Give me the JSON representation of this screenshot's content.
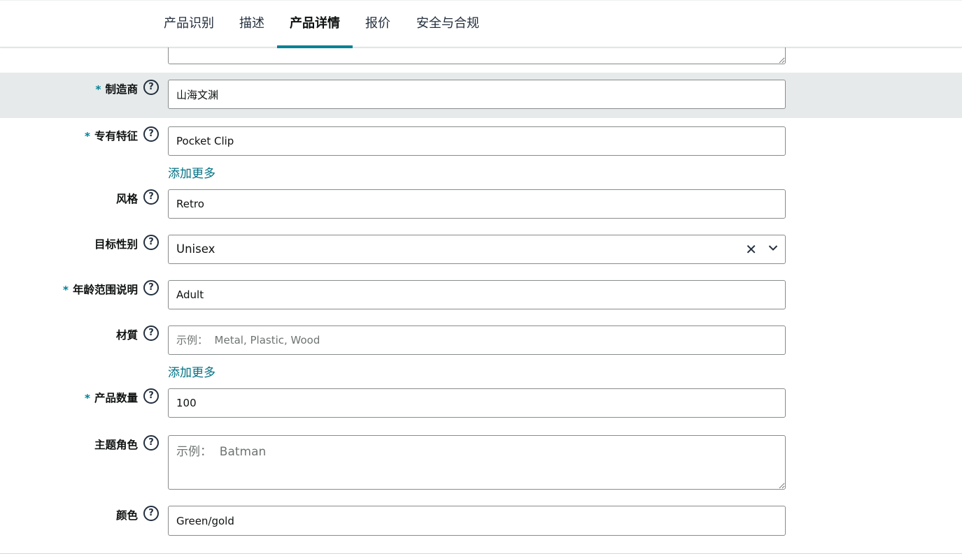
{
  "tabs": [
    {
      "label": "产品识别"
    },
    {
      "label": "描述"
    },
    {
      "label": "产品详情",
      "active": true
    },
    {
      "label": "报价"
    },
    {
      "label": "安全与合规"
    }
  ],
  "accent_color": "#008296",
  "help_icon_glyph": "?",
  "fields": {
    "manufacturer": {
      "required": "*",
      "label": "制造商",
      "value": "山海文渊"
    },
    "special_feature": {
      "required": "*",
      "label": "专有特征",
      "value": "Pocket Clip",
      "add_more": "添加更多"
    },
    "style": {
      "label": "风格",
      "value": "Retro"
    },
    "target_gender": {
      "label": "目标性别",
      "value": "Unisex",
      "clear_glyph": "✕"
    },
    "age_range": {
      "required": "*",
      "label": "年龄范围说明",
      "value": "Adult"
    },
    "material": {
      "label": "材質",
      "value": "",
      "placeholder": "示例：  Metal, Plastic, Wood",
      "add_more": "添加更多"
    },
    "item_quantity": {
      "required": "*",
      "label": "产品数量",
      "value": "100"
    },
    "theme_character": {
      "label": "主题角色",
      "value": "",
      "placeholder": "示例：  Batman"
    },
    "color": {
      "label": "颜色",
      "value": "Green/gold"
    }
  }
}
